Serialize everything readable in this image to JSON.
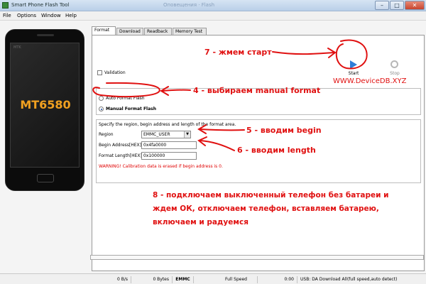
{
  "window": {
    "title": "Smart Phone Flash Tool",
    "faded_title": "Оповещения · Flash",
    "controls": {
      "minimize": "–",
      "maximize": "□",
      "close": "✕"
    }
  },
  "menu": [
    "File",
    "Options",
    "Window",
    "Help"
  ],
  "phone": {
    "brand_tiny": "MTK",
    "chip": "MT6580"
  },
  "tabs": [
    {
      "label": "Format",
      "active": true
    },
    {
      "label": "Download",
      "active": false
    },
    {
      "label": "Readback",
      "active": false
    },
    {
      "label": "Memory Test",
      "active": false
    }
  ],
  "format_tab": {
    "validation_label": "Validation",
    "validation_checked": false,
    "start_label": "Start",
    "stop_label": "Stop",
    "auto_format_label": "Auto Format Flash",
    "manual_format_label": "Manual Format Flash",
    "selected_mode": "manual",
    "instructions": "Specify the region, begin address and length of the format area.",
    "region_label": "Region",
    "region_value": "EMMC_USER",
    "begin_label": "Begin Address[HEX]:",
    "begin_value": "0x4fa0000",
    "length_label": "Format Length[HEX]:",
    "length_value": "0x100000",
    "warning": "WARNING! Calibration data is erased if begin address is 0."
  },
  "annotations": {
    "step7": "7 - жмем старт",
    "step4": "4 - выбираем manual format",
    "step5": "5 - вводим begin",
    "step6": "6 - вводим length",
    "step8_line1": "8 - подключаем выключенный телефон без батареи и",
    "step8_line2": "ждем ОК, отключаем телефон, вставляем батарею,",
    "step8_line3": "включаем и радуемся",
    "site": "WWW.DeviceDB.XYZ",
    "color": "#e01010"
  },
  "status": {
    "progress_fraction": 0.0,
    "speed": "0 B/s",
    "bytes": "0 Bytes",
    "storage": "EMMC",
    "mode": "Full Speed",
    "time": "0:00",
    "port": "USB: DA Download All(full speed,auto detect)"
  }
}
